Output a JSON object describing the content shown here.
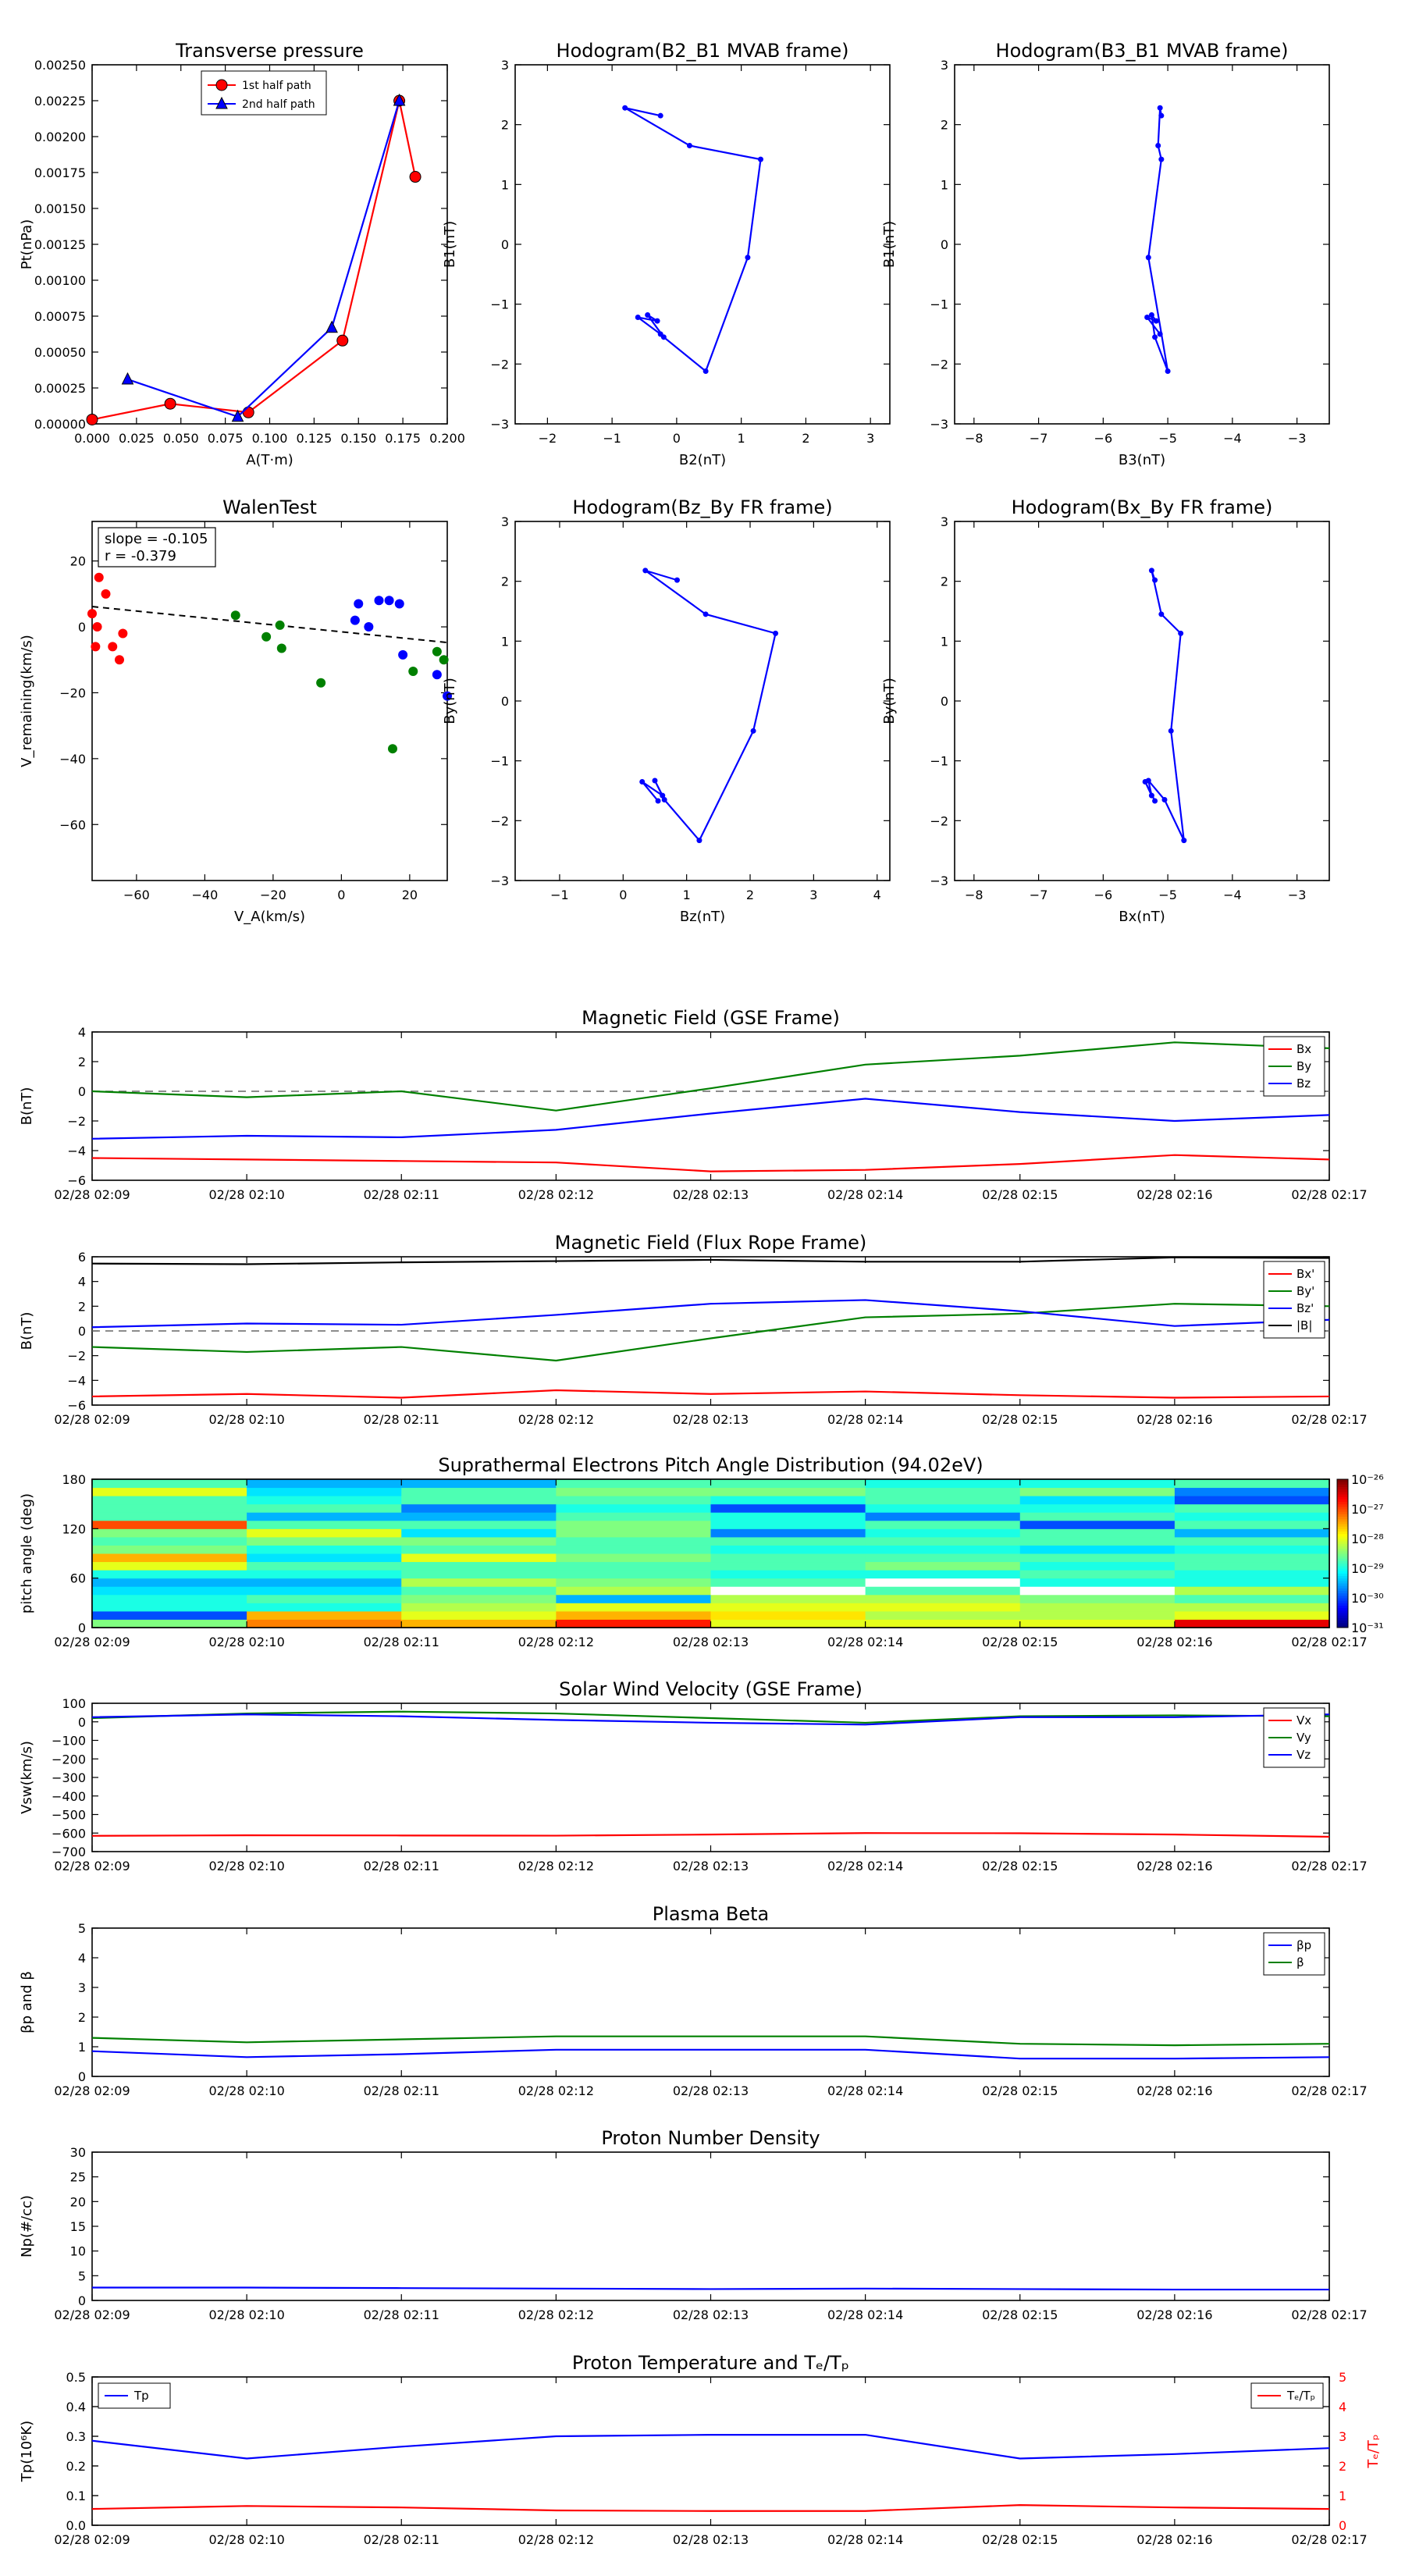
{
  "time_ticks": [
    "02/28 02:09",
    "02/28 02:10",
    "02/28 02:11",
    "02/28 02:12",
    "02/28 02:13",
    "02/28 02:14",
    "02/28 02:15",
    "02/28 02:16",
    "02/28 02:17"
  ],
  "colors": {
    "red": "#ff0000",
    "green": "#008000",
    "blue": "#0000ff",
    "black": "#000000"
  },
  "chart_data": [
    {
      "id": "transverse-pressure",
      "type": "line",
      "title": "Transverse pressure",
      "xlabel": "A(T·m)",
      "ylabel": "Pt(nPa)",
      "xlim": [
        0.0,
        0.2
      ],
      "ylim": [
        0.0,
        0.0025
      ],
      "xticks": [
        "0.000",
        "0.025",
        "0.050",
        "0.075",
        "0.100",
        "0.125",
        "0.150",
        "0.175",
        "0.200"
      ],
      "yticks": [
        "0.00000",
        "0.00025",
        "0.00050",
        "0.00075",
        "0.00100",
        "0.00125",
        "0.00150",
        "0.00175",
        "0.00200",
        "0.00225",
        "0.00250"
      ],
      "legend_position": "top-center",
      "series": [
        {
          "name": "1st half path",
          "color": "#ff0000",
          "marker": "circle",
          "x": [
            0.0,
            0.044,
            0.088,
            0.141,
            0.173,
            0.182
          ],
          "y": [
            3e-05,
            0.00014,
            8e-05,
            0.00058,
            0.00225,
            0.00172
          ]
        },
        {
          "name": "2nd half path",
          "color": "#0000ff",
          "marker": "triangle",
          "x": [
            0.02,
            0.082,
            0.135,
            0.173
          ],
          "y": [
            0.00031,
            5e-05,
            0.00067,
            0.00225
          ]
        }
      ]
    },
    {
      "id": "hodogram-b2-b1",
      "type": "line",
      "title": "Hodogram(B2_B1 MVAB frame)",
      "xlabel": "B2(nT)",
      "ylabel": "B1(nT)",
      "xlim": [
        -2.5,
        3.3
      ],
      "ylim": [
        -3,
        3
      ],
      "xticks": [
        "−2",
        "−1",
        "0",
        "1",
        "2",
        "3"
      ],
      "yticks": [
        "−3",
        "−2",
        "−1",
        "0",
        "1",
        "2",
        "3"
      ],
      "series": [
        {
          "color": "#0000ff",
          "marker": "dot",
          "x": [
            -0.25,
            -0.8,
            0.2,
            1.3,
            1.1,
            0.45,
            -0.2,
            -0.45,
            -0.3,
            -0.6,
            -0.25
          ],
          "y": [
            2.15,
            2.28,
            1.65,
            1.42,
            -0.22,
            -2.12,
            -1.55,
            -1.18,
            -1.28,
            -1.22,
            -1.5
          ]
        }
      ]
    },
    {
      "id": "hodogram-b3-b1",
      "type": "line",
      "title": "Hodogram(B3_B1 MVAB frame)",
      "xlabel": "B3(nT)",
      "ylabel": "B1(nT)",
      "xlim": [
        -8.3,
        -2.5
      ],
      "ylim": [
        -3,
        3
      ],
      "xticks": [
        "−8",
        "−7",
        "−6",
        "−5",
        "−4",
        "−3"
      ],
      "yticks": [
        "−3",
        "−2",
        "−1",
        "0",
        "1",
        "2",
        "3"
      ],
      "series": [
        {
          "color": "#0000ff",
          "marker": "dot",
          "x": [
            -5.1,
            -5.12,
            -5.15,
            -5.1,
            -5.3,
            -5.0,
            -5.2,
            -5.25,
            -5.18,
            -5.32,
            -5.12
          ],
          "y": [
            2.15,
            2.28,
            1.65,
            1.42,
            -0.22,
            -2.12,
            -1.55,
            -1.18,
            -1.28,
            -1.22,
            -1.5
          ]
        }
      ]
    },
    {
      "id": "walen-test",
      "type": "scatter",
      "title": "WalenTest",
      "xlabel": "V_A(km/s)",
      "ylabel": "V_remaining(km/s)",
      "xlim": [
        -73,
        31
      ],
      "ylim": [
        -77,
        32
      ],
      "xticks": [
        "−60",
        "−40",
        "−20",
        "0",
        "20"
      ],
      "yticks": [
        "−60",
        "−40",
        "−20",
        "0",
        "20"
      ],
      "annotation": [
        "slope = -0.105",
        "r = -0.379"
      ],
      "fit_line": {
        "slope": -0.105,
        "intercept": -1.5,
        "color": "#000000",
        "style": "dashed"
      },
      "series": [
        {
          "color": "#ff0000",
          "x": [
            -73,
            -72,
            -71,
            -69,
            -67,
            -65,
            -64,
            -71.5
          ],
          "y": [
            4,
            -6,
            15,
            10,
            -6,
            -10,
            -2,
            0
          ]
        },
        {
          "color": "#008000",
          "x": [
            -31,
            -22,
            -18,
            -17.5,
            -6,
            15,
            21,
            28,
            30
          ],
          "y": [
            3.5,
            -3,
            0.5,
            -6.5,
            -17,
            -37,
            -13.5,
            -7.5,
            -10
          ]
        },
        {
          "color": "#0000ff",
          "x": [
            4,
            5,
            8,
            11,
            14,
            17,
            18,
            28,
            31
          ],
          "y": [
            2,
            7,
            0,
            8,
            8,
            7,
            -8.5,
            -14.5,
            -21
          ]
        }
      ]
    },
    {
      "id": "hodogram-bz-by",
      "type": "line",
      "title": "Hodogram(Bz_By FR frame)",
      "xlabel": "Bz(nT)",
      "ylabel": "By(nT)",
      "xlim": [
        -1.7,
        4.2
      ],
      "ylim": [
        -3,
        3
      ],
      "xticks": [
        "−1",
        "0",
        "1",
        "2",
        "3",
        "4"
      ],
      "yticks": [
        "−3",
        "−2",
        "−1",
        "0",
        "1",
        "2",
        "3"
      ],
      "series": [
        {
          "color": "#0000ff",
          "marker": "dot",
          "x": [
            0.85,
            0.35,
            1.3,
            2.4,
            2.05,
            1.2,
            0.65,
            0.5,
            0.62,
            0.3,
            0.55
          ],
          "y": [
            2.02,
            2.18,
            1.45,
            1.13,
            -0.5,
            -2.33,
            -1.65,
            -1.33,
            -1.58,
            -1.35,
            -1.67
          ]
        }
      ]
    },
    {
      "id": "hodogram-bx-by",
      "type": "line",
      "title": "Hodogram(Bx_By FR frame)",
      "xlabel": "Bx(nT)",
      "ylabel": "By(nT)",
      "xlim": [
        -8.3,
        -2.5
      ],
      "ylim": [
        -3,
        3
      ],
      "xticks": [
        "−8",
        "−7",
        "−6",
        "−5",
        "−4",
        "−3"
      ],
      "yticks": [
        "−3",
        "−2",
        "−1",
        "0",
        "1",
        "2",
        "3"
      ],
      "series": [
        {
          "color": "#0000ff",
          "marker": "dot",
          "x": [
            -5.2,
            -5.25,
            -5.1,
            -4.8,
            -4.95,
            -4.75,
            -5.05,
            -5.3,
            -5.25,
            -5.35,
            -5.2
          ],
          "y": [
            2.02,
            2.18,
            1.45,
            1.13,
            -0.5,
            -2.33,
            -1.65,
            -1.33,
            -1.58,
            -1.35,
            -1.67
          ]
        }
      ]
    },
    {
      "id": "magnetic-field-gse",
      "type": "line",
      "title": "Magnetic Field (GSE Frame)",
      "ylabel": "B(nT)",
      "ylim": [
        -6,
        4
      ],
      "yticks": [
        "−6",
        "−4",
        "−2",
        "0",
        "2",
        "4"
      ],
      "zero_line": true,
      "legend_position": "right",
      "series": [
        {
          "name": "Bx",
          "color": "#ff0000",
          "values": [
            -4.5,
            -4.6,
            -4.7,
            -4.8,
            -5.4,
            -5.3,
            -4.9,
            -4.3,
            -4.6
          ]
        },
        {
          "name": "By",
          "color": "#008000",
          "values": [
            0.0,
            -0.4,
            0.0,
            -1.3,
            0.2,
            1.8,
            2.4,
            3.3,
            2.9
          ]
        },
        {
          "name": "Bz",
          "color": "#0000ff",
          "values": [
            -3.2,
            -3.0,
            -3.1,
            -2.6,
            -1.5,
            -0.5,
            -1.4,
            -2.0,
            -1.6
          ]
        }
      ]
    },
    {
      "id": "magnetic-field-fr",
      "type": "line",
      "title": "Magnetic Field (Flux Rope Frame)",
      "ylabel": "B(nT)",
      "ylim": [
        -6,
        6
      ],
      "yticks": [
        "−6",
        "−4",
        "−2",
        "0",
        "2",
        "4",
        "6"
      ],
      "zero_line": true,
      "legend_position": "right",
      "series": [
        {
          "name": "Bx'",
          "color": "#ff0000",
          "values": [
            -5.3,
            -5.1,
            -5.4,
            -4.8,
            -5.1,
            -4.9,
            -5.2,
            -5.4,
            -5.3
          ]
        },
        {
          "name": "By'",
          "color": "#008000",
          "values": [
            -1.3,
            -1.7,
            -1.3,
            -2.4,
            -0.6,
            1.1,
            1.4,
            2.2,
            2.0
          ]
        },
        {
          "name": "Bz'",
          "color": "#0000ff",
          "values": [
            0.3,
            0.6,
            0.5,
            1.3,
            2.2,
            2.5,
            1.6,
            0.4,
            0.9
          ]
        },
        {
          "name": "|B|",
          "color": "#000000",
          "values": [
            5.45,
            5.4,
            5.55,
            5.65,
            5.75,
            5.6,
            5.6,
            5.95,
            5.9
          ]
        }
      ]
    },
    {
      "id": "pitch-angle-distribution",
      "type": "heatmap",
      "title": "Suprathermal Electrons Pitch Angle Distribution (94.02eV)",
      "ylabel": "pitch angle (deg)",
      "ylim": [
        0,
        180
      ],
      "yticks": [
        "0",
        "60",
        "120",
        "180"
      ],
      "colorbar": {
        "labels": [
          "10⁻³¹",
          "10⁻³⁰",
          "10⁻²⁹",
          "10⁻²⁸",
          "10⁻²⁷",
          "10⁻²⁶"
        ]
      },
      "columns": 8,
      "rows": 18,
      "values": [
        [
          0.5,
          0.2,
          0.4,
          0.4,
          0.35,
          0.3,
          0.4,
          0.6,
          0.7,
          0.5,
          0.45,
          0.5,
          0.8,
          0.45,
          0.45,
          0.45,
          0.6,
          0.45
        ],
        [
          0.75,
          0.7,
          0.4,
          0.45,
          0.35,
          0.3,
          0.4,
          0.45,
          0.35,
          0.4,
          0.5,
          0.6,
          0.45,
          0.3,
          0.45,
          0.4,
          0.35,
          0.3
        ],
        [
          0.7,
          0.6,
          0.55,
          0.5,
          0.45,
          0.55,
          0.45,
          0.45,
          0.6,
          0.45,
          0.5,
          0.35,
          0.45,
          0.3,
          0.25,
          0.45,
          0.45,
          0.3
        ],
        [
          0.85,
          0.7,
          0.6,
          0.3,
          0.55,
          0.5,
          0.45,
          0.45,
          0.5,
          0.45,
          0.45,
          0.5,
          0.5,
          0.45,
          0.4,
          0.45,
          0.5,
          0.45
        ],
        [
          0.6,
          0.65,
          0.6,
          0.55,
          0.0,
          0.45,
          0.4,
          0.45,
          0.45,
          0.4,
          0.45,
          0.25,
          0.4,
          0.4,
          0.2,
          0.4,
          0.5,
          0.45
        ],
        [
          0.6,
          0.55,
          0.6,
          0.55,
          0.45,
          0.0,
          0.4,
          0.5,
          0.45,
          0.4,
          0.45,
          0.4,
          0.45,
          0.25,
          0.4,
          0.45,
          0.45,
          0.4
        ],
        [
          0.6,
          0.55,
          0.55,
          0.5,
          0.0,
          0.4,
          0.45,
          0.4,
          0.45,
          0.35,
          0.45,
          0.45,
          0.2,
          0.45,
          0.4,
          0.35,
          0.5,
          0.4
        ],
        [
          0.9,
          0.6,
          0.55,
          0.45,
          0.55,
          0.4,
          0.4,
          0.45,
          0.45,
          0.4,
          0.45,
          0.3,
          0.45,
          0.4,
          0.45,
          0.2,
          0.25,
          0.45
        ]
      ]
    },
    {
      "id": "solar-wind-velocity",
      "type": "line",
      "title": "Solar Wind Velocity (GSE Frame)",
      "ylabel": "Vsw(km/s)",
      "ylim": [
        -700,
        100
      ],
      "yticks": [
        "−700",
        "−600",
        "−500",
        "−400",
        "−300",
        "−200",
        "−100",
        "0",
        "100"
      ],
      "legend_position": "right",
      "series": [
        {
          "name": "Vx",
          "color": "#ff0000",
          "values": [
            -615,
            -612,
            -613,
            -614,
            -608,
            -600,
            -601,
            -608,
            -620
          ]
        },
        {
          "name": "Vy",
          "color": "#008000",
          "values": [
            20,
            45,
            55,
            45,
            20,
            -5,
            30,
            35,
            30
          ]
        },
        {
          "name": "Vz",
          "color": "#0000ff",
          "values": [
            25,
            40,
            30,
            10,
            -5,
            -15,
            25,
            25,
            40
          ]
        }
      ]
    },
    {
      "id": "plasma-beta",
      "type": "line",
      "title": "Plasma Beta",
      "ylabel": "βp and β",
      "ylim": [
        0,
        5
      ],
      "yticks": [
        "0",
        "1",
        "2",
        "3",
        "4",
        "5"
      ],
      "legend_position": "top-right",
      "series": [
        {
          "name": "βp",
          "color": "#0000ff",
          "values": [
            0.85,
            0.65,
            0.75,
            0.9,
            0.9,
            0.9,
            0.6,
            0.6,
            0.65
          ]
        },
        {
          "name": "β",
          "color": "#008000",
          "values": [
            1.3,
            1.15,
            1.25,
            1.35,
            1.35,
            1.35,
            1.1,
            1.05,
            1.1
          ]
        }
      ]
    },
    {
      "id": "proton-number-density",
      "type": "line",
      "title": "Proton Number Density",
      "ylabel": "Np(#/cc)",
      "ylim": [
        0,
        30
      ],
      "yticks": [
        "0",
        "5",
        "10",
        "15",
        "20",
        "25",
        "30"
      ],
      "series": [
        {
          "color": "#0000ff",
          "values": [
            2.6,
            2.6,
            2.5,
            2.4,
            2.3,
            2.4,
            2.3,
            2.2,
            2.2
          ]
        }
      ]
    },
    {
      "id": "proton-temperature",
      "type": "line",
      "title": "Proton Temperature and Tₑ/Tₚ",
      "ylabel": "Tp(10⁶K)",
      "ylabel_right": "Tₑ/Tₚ",
      "ylim": [
        0,
        0.5
      ],
      "ylim_right": [
        0,
        5
      ],
      "yticks": [
        "0.0",
        "0.1",
        "0.2",
        "0.3",
        "0.4",
        "0.5"
      ],
      "yticks_right": [
        "0",
        "1",
        "2",
        "3",
        "4",
        "5"
      ],
      "series": [
        {
          "name": "Tp",
          "color": "#0000ff",
          "axis": "left",
          "values": [
            0.285,
            0.225,
            0.265,
            0.3,
            0.305,
            0.305,
            0.225,
            0.24,
            0.26
          ]
        },
        {
          "name": "Tₑ/Tₚ",
          "color": "#ff0000",
          "axis": "right",
          "values": [
            0.55,
            0.65,
            0.6,
            0.5,
            0.48,
            0.48,
            0.68,
            0.6,
            0.55
          ]
        }
      ]
    }
  ]
}
